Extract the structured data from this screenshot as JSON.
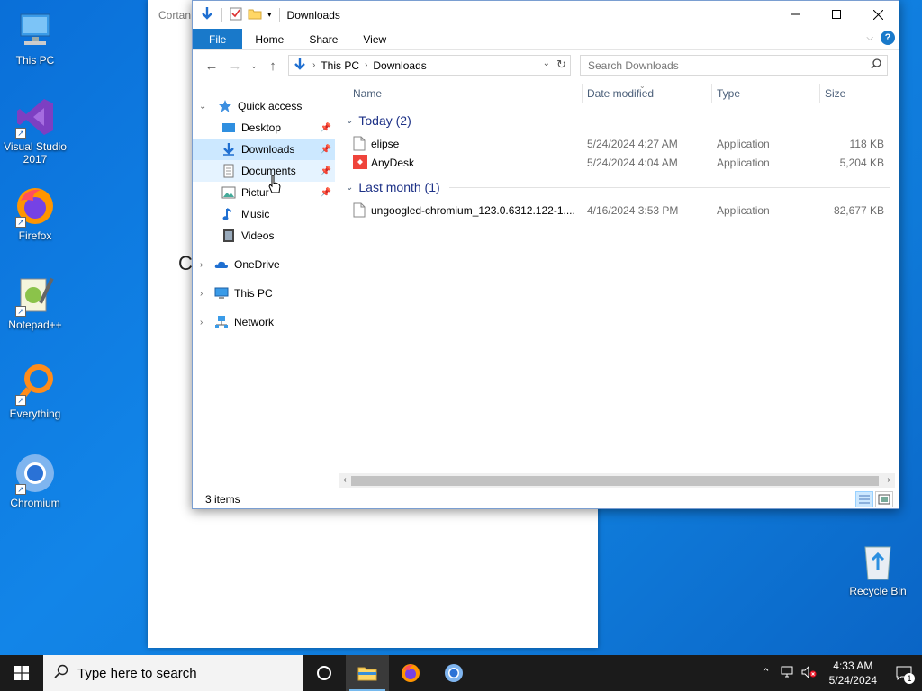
{
  "desktop": {
    "icons": [
      {
        "label": "This PC",
        "icon": "this-pc-icon"
      },
      {
        "label": "Visual Studio 2017",
        "icon": "visual-studio-icon"
      },
      {
        "label": "Firefox",
        "icon": "firefox-icon"
      },
      {
        "label": "Notepad++",
        "icon": "notepadpp-icon"
      },
      {
        "label": "Everything",
        "icon": "everything-icon"
      },
      {
        "label": "Chromium",
        "icon": "chromium-icon"
      },
      {
        "label": "Recycle Bin",
        "icon": "recycle-bin-icon"
      }
    ]
  },
  "background_window": {
    "title": "Cortan",
    "stray_glyph": "C"
  },
  "explorer": {
    "title": "Downloads",
    "ribbon": {
      "tabs": [
        "File",
        "Home",
        "Share",
        "View"
      ]
    },
    "address": {
      "crumbs": [
        "This PC",
        "Downloads"
      ],
      "search_placeholder": "Search Downloads"
    },
    "nav": {
      "quick_access": "Quick access",
      "quick_items": [
        "Desktop",
        "Downloads",
        "Documents",
        "Pictur"
      ],
      "other_quick_items": [
        "Music",
        "Videos"
      ],
      "roots": [
        "OneDrive",
        "This PC",
        "Network"
      ]
    },
    "columns": [
      "Name",
      "Date modified",
      "Type",
      "Size"
    ],
    "groups": [
      {
        "label": "Today (2)",
        "files": [
          {
            "name": "elipse",
            "date": "5/24/2024 4:27 AM",
            "type": "Application",
            "size": "118 KB"
          },
          {
            "name": "AnyDesk",
            "date": "5/24/2024 4:04 AM",
            "type": "Application",
            "size": "5,204 KB"
          }
        ]
      },
      {
        "label": "Last month (1)",
        "files": [
          {
            "name": "ungoogled-chromium_123.0.6312.122-1....",
            "date": "4/16/2024 3:53 PM",
            "type": "Application",
            "size": "82,677 KB"
          }
        ]
      }
    ],
    "status": "3 items"
  },
  "taskbar": {
    "search_placeholder": "Type here to search",
    "time": "4:33 AM",
    "date": "5/24/2024",
    "notification_count": "1"
  },
  "colors": {
    "accent": "#1979ca",
    "selection": "#cce8ff",
    "group_header": "#1e3287"
  }
}
